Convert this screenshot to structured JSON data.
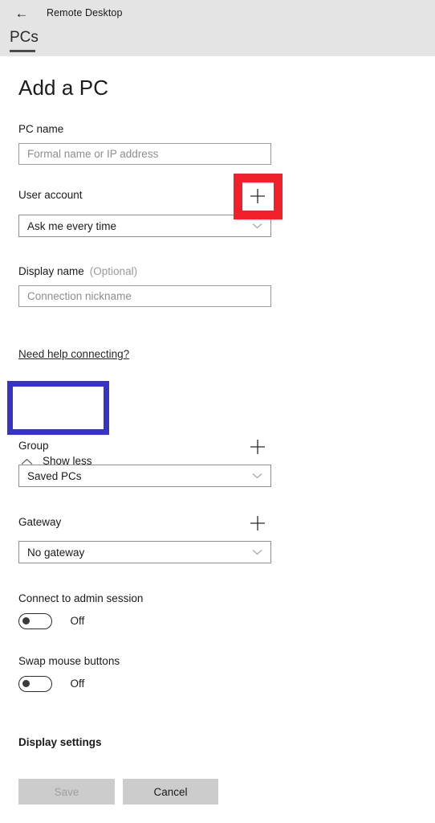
{
  "titlebar": {
    "back_icon": "back-arrow-icon",
    "app_title": "Remote Desktop",
    "tabs": [
      {
        "label": "PCs",
        "selected": true
      }
    ]
  },
  "page": {
    "title": "Add a PC",
    "fields": {
      "pc_name": {
        "label": "PC name",
        "placeholder": "Formal name or IP address",
        "value": ""
      },
      "user_account": {
        "label": "User account",
        "selected": "Ask me every time",
        "add_icon": "plus-icon"
      },
      "display_name": {
        "label": "Display name",
        "optional": "(Optional)",
        "placeholder": "Connection nickname",
        "value": ""
      },
      "group": {
        "label": "Group",
        "selected": "Saved PCs",
        "add_icon": "plus-icon"
      },
      "gateway": {
        "label": "Gateway",
        "selected": "No gateway",
        "add_icon": "plus-icon"
      }
    },
    "help_link": "Need help connecting?",
    "show_less": {
      "label": "Show less",
      "icon": "chevron-up-icon"
    },
    "toggles": [
      {
        "label": "Connect to admin session",
        "state": "Off"
      },
      {
        "label": "Swap mouse buttons",
        "state": "Off"
      }
    ],
    "display_settings_heading": "Display settings",
    "buttons": {
      "save": "Save",
      "cancel": "Cancel"
    }
  },
  "annotations": [
    {
      "name": "user-account-add-highlight",
      "color": "#f1212b"
    },
    {
      "name": "show-less-highlight",
      "color": "#3734c4"
    }
  ]
}
